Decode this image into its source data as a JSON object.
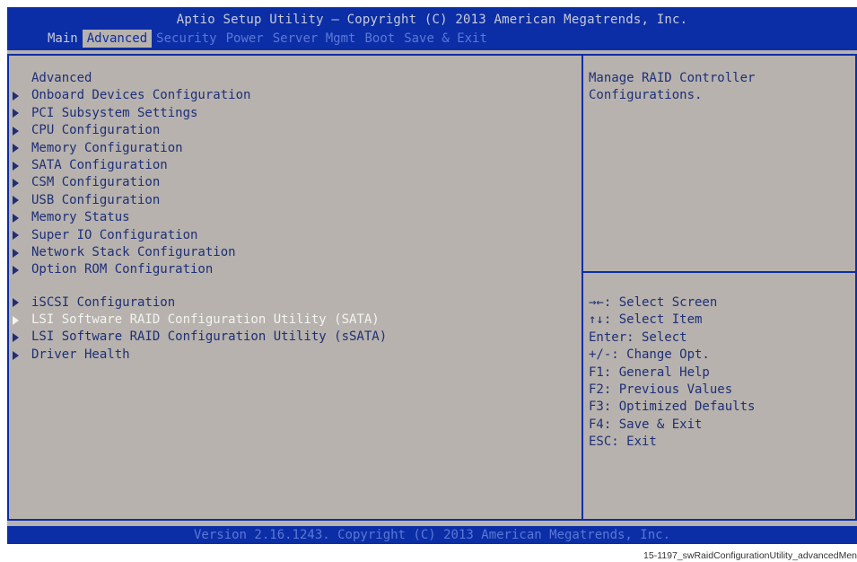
{
  "header": {
    "title": "Aptio Setup Utility – Copyright (C) 2013 American Megatrends, Inc.",
    "tabs": [
      {
        "label": "Main",
        "state": "light"
      },
      {
        "label": "Advanced",
        "state": "active"
      },
      {
        "label": "Security",
        "state": "dim"
      },
      {
        "label": "Power",
        "state": "dim"
      },
      {
        "label": "Server Mgmt",
        "state": "dim"
      },
      {
        "label": "Boot",
        "state": "dim"
      },
      {
        "label": "Save & Exit",
        "state": "dim"
      }
    ]
  },
  "menu": {
    "heading": "Advanced",
    "items": [
      "Onboard Devices Configuration",
      "PCI Subsystem Settings",
      "CPU Configuration",
      "Memory Configuration",
      "SATA Configuration",
      "CSM Configuration",
      "USB Configuration",
      "Memory Status",
      "Super IO Configuration",
      "Network Stack Configuration",
      "Option ROM Configuration",
      "iSCSI Configuration",
      "LSI Software RAID Configuration Utility (SATA)",
      "LSI Software RAID Configuration Utility (sSATA)",
      "Driver Health"
    ],
    "selected_index": 12,
    "arrow_icon": "right-triangle-icon"
  },
  "help": {
    "text": "Manage RAID Controller\nConfigurations."
  },
  "keys": [
    "→←: Select Screen",
    "↑↓: Select Item",
    "Enter: Select",
    "+/-: Change Opt.",
    "F1: General Help",
    "F2: Previous Values",
    "F3: Optimized Defaults",
    "F4: Save & Exit",
    "ESC: Exit"
  ],
  "footer": {
    "text": "Version 2.16.1243. Copyright (C) 2013 American Megatrends, Inc."
  },
  "caption": "15-1197_swRaidConfigurationUtility_advancedMen",
  "colors": {
    "bios_blue": "#0b2ea6",
    "background_gray": "#b7b2ad",
    "text_navy": "#1e2f78",
    "highlight_white": "#f4f3f0"
  }
}
